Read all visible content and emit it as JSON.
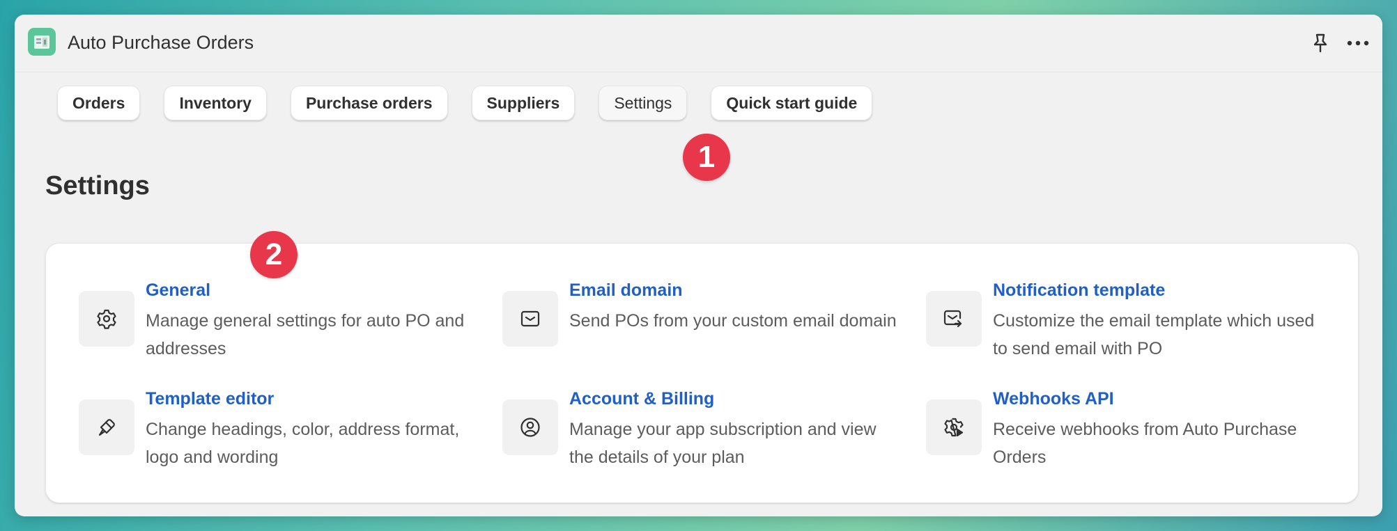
{
  "app": {
    "title": "Auto Purchase Orders"
  },
  "titlebar": {
    "pin_icon": "pin-icon",
    "more_icon": "more-horizontal-icon"
  },
  "tabs": [
    {
      "label": "Orders"
    },
    {
      "label": "Inventory"
    },
    {
      "label": "Purchase orders"
    },
    {
      "label": "Suppliers"
    },
    {
      "label": "Settings",
      "active": true
    },
    {
      "label": "Quick start guide"
    }
  ],
  "markers": [
    {
      "label": "1"
    },
    {
      "label": "2"
    }
  ],
  "page": {
    "title": "Settings"
  },
  "settings": [
    {
      "title": "General",
      "description": "Manage general settings for auto PO and addresses",
      "icon": "gear-icon"
    },
    {
      "title": "Email domain",
      "description": "Send POs from your custom email domain",
      "icon": "envelope-icon"
    },
    {
      "title": "Notification template",
      "description": "Customize the email template which used to send email with PO",
      "icon": "email-forward-icon"
    },
    {
      "title": "Template editor",
      "description": "Change headings, color, address format, logo and wording",
      "icon": "paintbrush-icon"
    },
    {
      "title": "Account & Billing",
      "description": "Manage your app subscription and view the details of your plan",
      "icon": "profile-icon"
    },
    {
      "title": "Webhooks API",
      "description": "Receive webhooks from Auto Purchase Orders",
      "icon": "gear-play-icon"
    }
  ],
  "colors": {
    "link": "#1f5fc7",
    "marker": "#e8374a",
    "app_icon": "#5bc69a"
  }
}
